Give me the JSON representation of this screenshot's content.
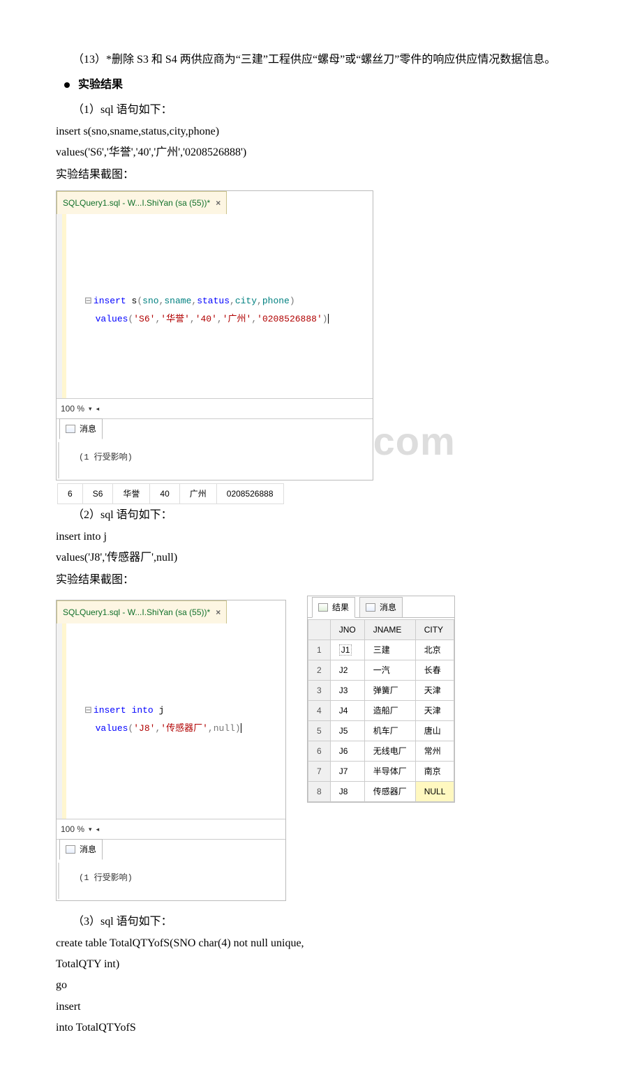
{
  "watermark": "www.bdocx.com",
  "body": {
    "q13": "（13）*删除 S3 和 S4 两供应商为“三建”工程供应“螺母”或“螺丝刀”零件的响应供应情况数据信息。",
    "section_result": "实验结果",
    "s1_label": "（1）sql 语句如下：",
    "s1_sql1": "insert s(sno,sname,status,city,phone)",
    "s1_sql2": "values('S6','华誉','40','广州','0208526888')",
    "shot_caption": "实验结果截图：",
    "s2_label": "（2）sql 语句如下：",
    "s2_sql1": "insert into j",
    "s2_sql2": "values('J8','传感器厂',null)",
    "s3_label": "（3）sql 语句如下：",
    "s3_sql1": "create table TotalQTYofS(SNO char(4) not null unique,",
    "s3_sql2": "TotalQTY int)",
    "s3_sql3": "go",
    "s3_sql4": "insert",
    "s3_sql5": "into TotalQTYofS"
  },
  "ssms1": {
    "tab": "SQLQuery1.sql - W...I.ShiYan (sa (55))*",
    "zoom": "100 %",
    "msg_tab": "消息",
    "msg_body": "(1 行受影响)",
    "code": {
      "l1_insert": "insert",
      "l1_tail": " s",
      "l1_paren_open": "(",
      "l1_sno": "sno",
      "l1_c1": ",",
      "l1_sname": "sname",
      "l1_c2": ",",
      "l1_status": "status",
      "l1_c3": ",",
      "l1_city": "city",
      "l1_c4": ",",
      "l1_phone": "phone",
      "l1_paren_close": ")",
      "l2_values": "values",
      "l2_po": "(",
      "l2_v1": "'S6'",
      "l2_c1": ",",
      "l2_v2": "'华誉'",
      "l2_c2": ",",
      "l2_v3": "'40'",
      "l2_c3": ",",
      "l2_v4": "'广州'",
      "l2_c4": ",",
      "l2_v5": "'0208526888'",
      "l2_pc": ")"
    },
    "flat_row": [
      "6",
      "S6",
      "华誉",
      "40",
      "广州",
      "0208526888"
    ]
  },
  "ssms2": {
    "tab": "SQLQuery1.sql - W...I.ShiYan (sa (55))*",
    "zoom": "100 %",
    "msg_tab": "消息",
    "msg_body": "(1 行受影响)",
    "code": {
      "l1_insert": "insert",
      "l1_into": " into",
      "l1_tail": " j",
      "l2_values": "values",
      "l2_po": "(",
      "l2_v1": "'J8'",
      "l2_c1": ",",
      "l2_v2": "'传感器厂'",
      "l2_c2": ",",
      "l2_null": "null",
      "l2_pc": ")"
    }
  },
  "grid": {
    "res_tab": "结果",
    "msg_tab": "消息",
    "headers": [
      "",
      "JNO",
      "JNAME",
      "CITY"
    ],
    "rows": [
      [
        "1",
        "J1",
        "三建",
        "北京"
      ],
      [
        "2",
        "J2",
        "一汽",
        "长春"
      ],
      [
        "3",
        "J3",
        "弹簧厂",
        "天津"
      ],
      [
        "4",
        "J4",
        "造船厂",
        "天津"
      ],
      [
        "5",
        "J5",
        "机车厂",
        "唐山"
      ],
      [
        "6",
        "J6",
        "无线电厂",
        "常州"
      ],
      [
        "7",
        "J7",
        "半导体厂",
        "南京"
      ],
      [
        "8",
        "J8",
        "传感器厂",
        "NULL"
      ]
    ]
  }
}
